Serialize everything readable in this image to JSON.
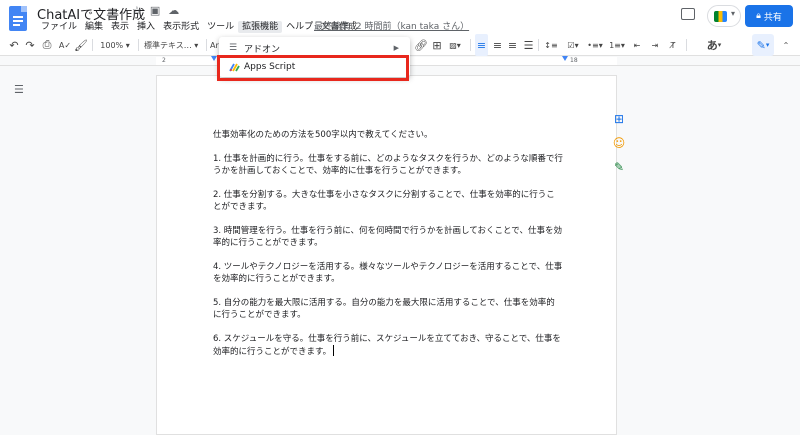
{
  "app": {
    "title": "ChatAIで文書作成",
    "title_icons": [
      "star-icon",
      "folder-icon",
      "cloud-icon"
    ],
    "brand_color": "#4285f4",
    "accent_color": "#1a73e8",
    "highlight_color": "#e8281d"
  },
  "menubar": {
    "items": [
      "ファイル",
      "編集",
      "表示",
      "挿入",
      "表示形式",
      "ツール",
      "拡張機能",
      "ヘルプ",
      "文書作成"
    ],
    "active_index": 6,
    "last_edit": "最終編集: 2 時間前（kan taka さん）"
  },
  "header": {
    "share_label": "共有"
  },
  "toolbar": {
    "zoom": "100%",
    "style": "標準テキス…",
    "font": "Ari",
    "ime": "あ"
  },
  "ruler": {
    "ticks": [
      "2",
      "18"
    ]
  },
  "extensions_menu": {
    "items": [
      {
        "label": "アドオン",
        "icon": "addon-icon",
        "has_submenu": true
      },
      {
        "label": "Apps Script",
        "icon": "apps-script-icon",
        "has_submenu": false
      }
    ]
  },
  "document": {
    "paragraphs": [
      "仕事効率化のための方法を500字以内で教えてください。",
      "1. 仕事を計画的に行う。仕事をする前に、どのようなタスクを行うか、どのような順番で行うかを計画しておくことで、効率的に仕事を行うことができます。",
      "2. 仕事を分割する。大きな仕事を小さなタスクに分割することで、仕事を効率的に行うことができます。",
      "3. 時間管理を行う。仕事を行う前に、何を何時間で行うかを計画しておくことで、仕事を効率的に行うことができます。",
      "4. ツールやテクノロジーを活用する。様々なツールやテクノロジーを活用することで、仕事を効率的に行うことができます。",
      "5. 自分の能力を最大限に活用する。自分の能力を最大限に活用することで、仕事を効率的に行うことができます。",
      "6. スケジュールを守る。仕事を行う前に、スケジュールを立てておき、守ることで、仕事を効率的に行うことができます。"
    ]
  }
}
